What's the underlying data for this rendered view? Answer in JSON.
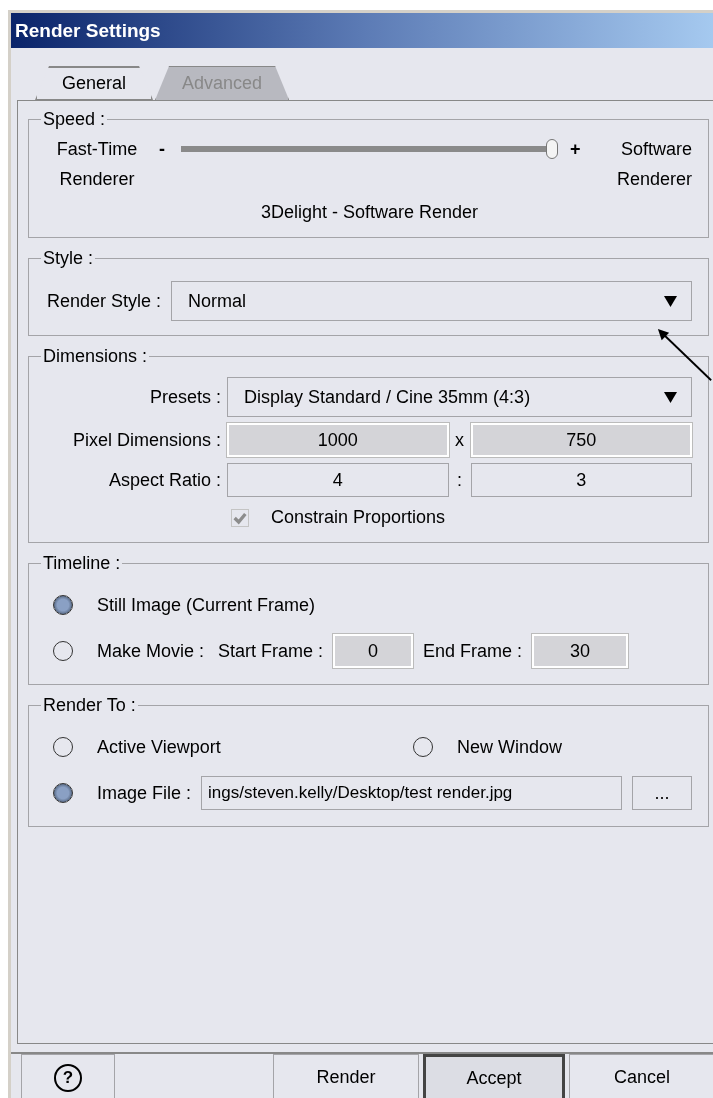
{
  "window": {
    "title": "Render Settings"
  },
  "tabs": [
    {
      "label": "General",
      "selected": true
    },
    {
      "label": "Advanced",
      "selected": false
    }
  ],
  "speed": {
    "title": "Speed :",
    "left_label": "Fast-Time Renderer",
    "right_label": "Software Renderer",
    "minus": "-",
    "plus": "+",
    "level": 1,
    "caption": "3Delight - Software Render"
  },
  "style": {
    "title": "Style :",
    "label": "Render Style :",
    "value": "Normal"
  },
  "dimensions": {
    "title": "Dimensions :",
    "presets_label": "Presets :",
    "presets_value": "Display Standard / Cine 35mm (4:3)",
    "pixel_label": "Pixel Dimensions :",
    "pixel_width": {
      "value": "1000",
      "disabled": true
    },
    "pixel_sep": "x",
    "pixel_height": {
      "value": "750",
      "disabled": true
    },
    "aspect_label": "Aspect Ratio :",
    "aspect_width": {
      "value": "4",
      "disabled": false
    },
    "aspect_sep": ":",
    "aspect_height": {
      "value": "3",
      "disabled": false
    },
    "constrain": {
      "label": "Constrain Proportions",
      "checked": true,
      "disabled": true
    }
  },
  "timeline": {
    "title": "Timeline :",
    "options": [
      {
        "label": "Still Image (Current Frame)",
        "selected": true
      },
      {
        "label": "Make Movie :",
        "selected": false
      }
    ],
    "start_label": "Start Frame :",
    "start_field": {
      "value": "0",
      "disabled": true
    },
    "end_label": "End Frame :",
    "end_field": {
      "value": "30",
      "disabled": true
    }
  },
  "render_to": {
    "title": "Render To :",
    "options": [
      {
        "label": "Active Viewport",
        "selected": false
      },
      {
        "label": "New Window",
        "selected": false
      },
      {
        "label": "Image File :",
        "selected": true
      }
    ],
    "file_path": "ings/steven.kelly/Desktop/test render.jpg",
    "browse": "..."
  },
  "buttons": [
    {
      "kind": "help",
      "label": "?"
    },
    {
      "kind": "spacer"
    },
    {
      "kind": "text",
      "label": "Render",
      "default": false
    },
    {
      "kind": "text",
      "label": "Accept",
      "default": true
    },
    {
      "kind": "text",
      "label": "Cancel",
      "default": false
    }
  ]
}
